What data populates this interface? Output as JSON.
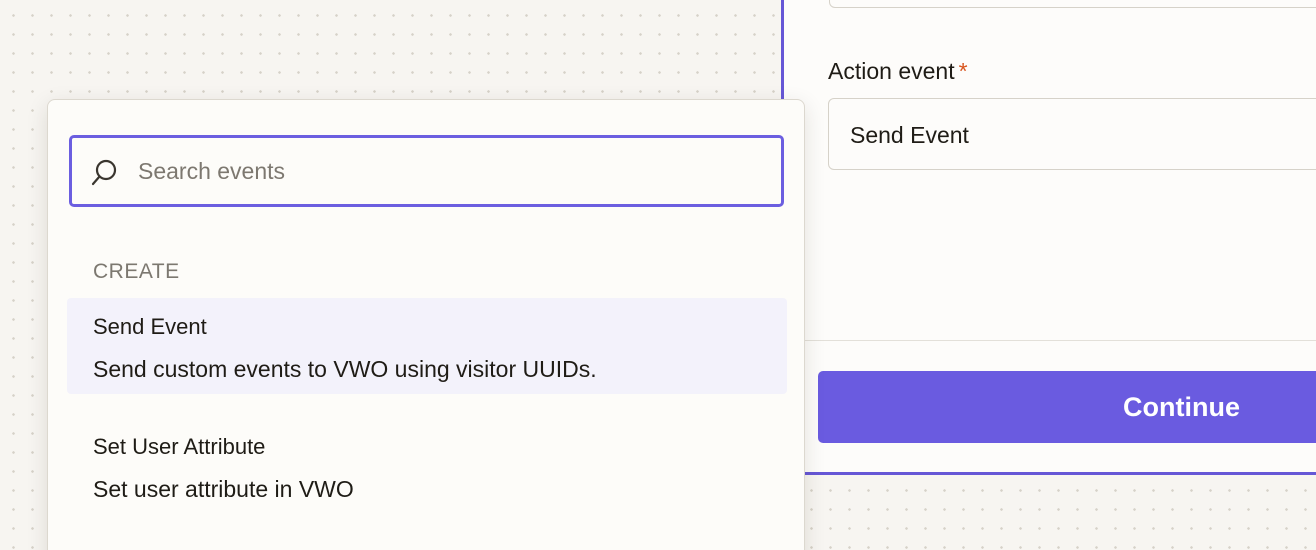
{
  "panel": {
    "action_event": {
      "label": "Action event",
      "required_marker": "*",
      "value": "Send Event"
    },
    "continue_label": "Continue"
  },
  "dropdown": {
    "search_placeholder": "Search events",
    "group_label": "CREATE",
    "options": [
      {
        "title": "Send Event",
        "description": "Send custom events to VWO using visitor UUIDs.",
        "highlighted": true
      },
      {
        "title": "Set User Attribute",
        "description": "Set user attribute in VWO",
        "highlighted": false
      }
    ]
  },
  "colors": {
    "accent": "#6a5be0",
    "required": "#d8551e",
    "highlight": "#f3f2fb"
  }
}
